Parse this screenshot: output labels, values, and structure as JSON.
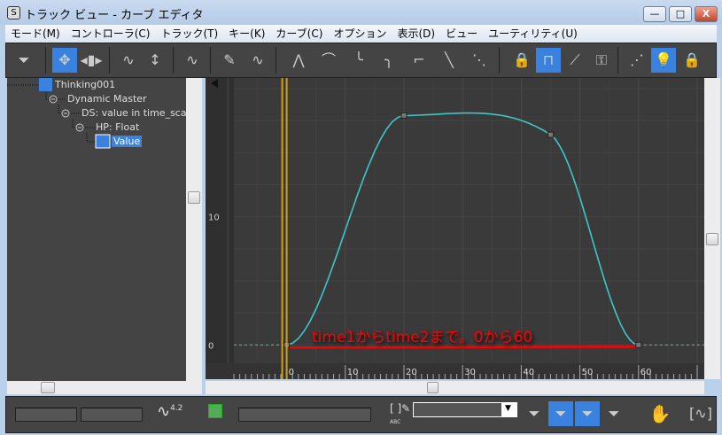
{
  "window": {
    "title": "トラック ビュー - カーブ エディタ",
    "icon": "3dsmax-icon",
    "minimize": "—",
    "maximize": "□",
    "close": "X"
  },
  "menu": [
    "モード(M)",
    "コントローラ(C)",
    "トラック(T)",
    "キー(K)",
    "カーブ(C)",
    "オプション",
    "表示(D)",
    "ビュー",
    "ユーティリティ(U)"
  ],
  "toolbar": [
    {
      "icon": "filter-icon",
      "glyph": "⏷",
      "active": false
    },
    {
      "icon": "move-keys-icon",
      "glyph": "✥",
      "active": true
    },
    {
      "icon": "slide-keys-icon",
      "glyph": "◂▮▸",
      "active": false
    },
    {
      "icon": "scale-keys-icon",
      "glyph": "∿",
      "active": false
    },
    {
      "icon": "scale-values-icon",
      "glyph": "↕",
      "active": false
    },
    {
      "icon": "add-keys-icon",
      "glyph": "∿",
      "active": false
    },
    {
      "icon": "draw-curves-icon",
      "glyph": "✎",
      "active": false
    },
    {
      "icon": "reduce-keys-icon",
      "glyph": "∿",
      "active": false
    },
    {
      "icon": "auto-tangent-icon",
      "glyph": "⋀",
      "active": false
    },
    {
      "icon": "spline-tangent-icon",
      "glyph": "⌒",
      "active": false
    },
    {
      "icon": "fast-tangent-icon",
      "glyph": "╰",
      "active": false
    },
    {
      "icon": "slow-tangent-icon",
      "glyph": "╮",
      "active": false
    },
    {
      "icon": "step-tangent-icon",
      "glyph": "⌐",
      "active": false
    },
    {
      "icon": "linear-tangent-icon",
      "glyph": "╲",
      "active": false
    },
    {
      "icon": "smooth-tangent-icon",
      "glyph": "⋱",
      "active": false
    },
    {
      "icon": "lock-selection-icon",
      "glyph": "🔒",
      "active": false
    },
    {
      "icon": "snap-frames-icon",
      "glyph": "⊓",
      "active": true
    },
    {
      "icon": "parameter-curve-oor-icon",
      "glyph": "⟋",
      "active": false
    },
    {
      "icon": "show-keyable-icon",
      "glyph": "⚿",
      "active": false
    },
    {
      "icon": "show-all-tangents-icon",
      "glyph": "⋰",
      "active": false
    },
    {
      "icon": "show-tangents-icon",
      "glyph": "💡",
      "active": true
    },
    {
      "icon": "lock-tangents-icon",
      "glyph": "🔒",
      "active": false
    }
  ],
  "tree": [
    {
      "label": "Thinking001",
      "icon": "object-icon",
      "depth": 0
    },
    {
      "label": "Dynamic Master",
      "icon": "collapse-icon",
      "depth": 1
    },
    {
      "label": "DS: value in time_scale",
      "icon": "collapse-icon",
      "depth": 2
    },
    {
      "label": "HP: Float",
      "icon": "collapse-icon",
      "depth": 3
    },
    {
      "label": "Value",
      "icon": "curve-icon",
      "depth": 4,
      "selected": true
    }
  ],
  "chart_data": {
    "type": "line",
    "x_ticks": [
      "0",
      "10",
      "20",
      "30",
      "40",
      "50",
      "60"
    ],
    "y_ticks": [
      "0",
      "10"
    ],
    "xlim": [
      -9,
      70
    ],
    "ylim": [
      -0.6,
      20
    ],
    "keys": [
      {
        "frame": 0,
        "value": 0
      },
      {
        "frame": 20,
        "value": 17.9
      },
      {
        "frame": 45,
        "value": 16.4
      },
      {
        "frame": 60,
        "value": 0
      }
    ],
    "curve_color": "#3cc8c8",
    "range_bar": {
      "from": 0,
      "to": 60,
      "color": "#ff0000"
    },
    "time_slider_frame": 0,
    "time_slider_color": "#d4a017",
    "annotation": "time1からtime2まで。0から60",
    "annotation_color": "#ff0000"
  },
  "bottom": {
    "curve_value_icon": "curve-value-icon",
    "curve_value_label": "4.2",
    "selected_objects": "",
    "abc_icon": "rename-icon",
    "abc_label": "ABC",
    "hand_icon": "pan-icon",
    "fit_icon": "zoom-extents-icon"
  },
  "scroll": {
    "h_position": 0.45
  }
}
